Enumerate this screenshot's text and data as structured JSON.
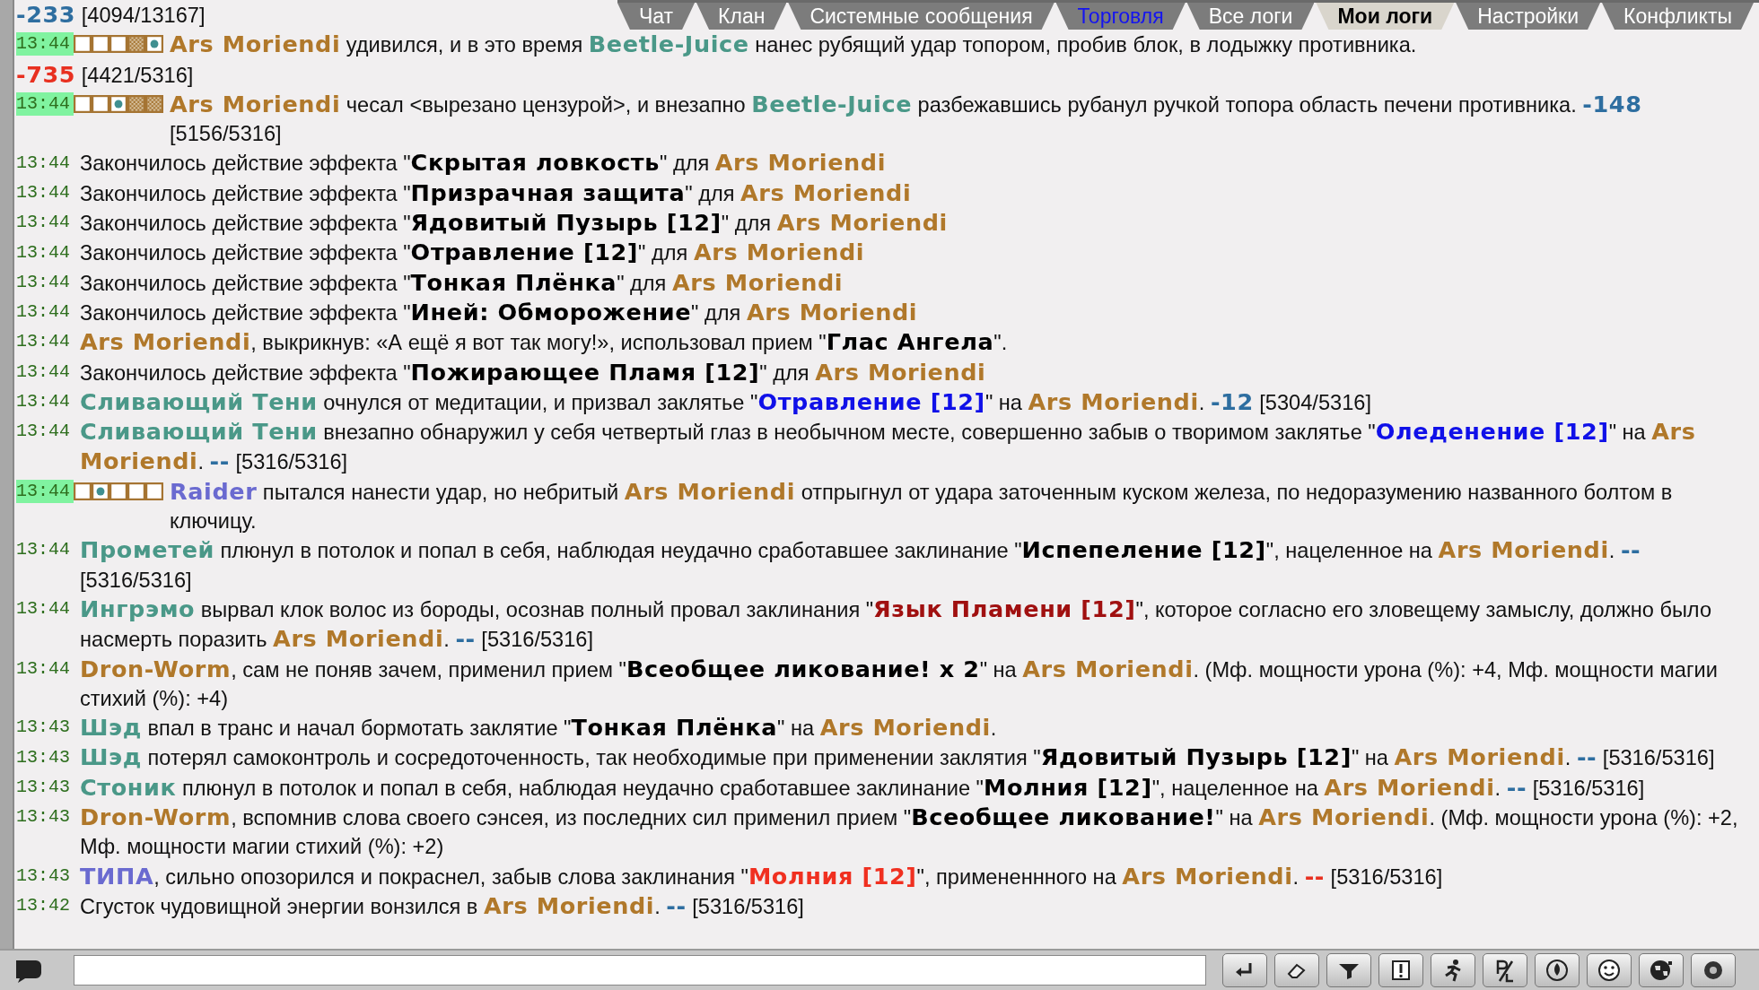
{
  "tabs": [
    {
      "label": "Чат",
      "selected": false,
      "unread": false
    },
    {
      "label": "Клан",
      "selected": false,
      "unread": false
    },
    {
      "label": "Системные сообщения",
      "selected": false,
      "unread": false
    },
    {
      "label": "Торговля",
      "selected": false,
      "unread": true
    },
    {
      "label": "Все логи",
      "selected": false,
      "unread": false
    },
    {
      "label": "Мои логи",
      "selected": true,
      "unread": false
    },
    {
      "label": "Настройки",
      "selected": false,
      "unread": false
    },
    {
      "label": "Конфликты",
      "selected": false,
      "unread": false
    }
  ],
  "log": [
    {
      "segments": [
        {
          "kind": "damage-blue",
          "text": "-233"
        },
        {
          "kind": "text",
          "text": " [4094/13167]"
        }
      ]
    },
    {
      "time": "13:44",
      "highlighted": true,
      "marks": [
        {
          "kind": "empty"
        },
        {
          "kind": "empty"
        },
        {
          "kind": "empty"
        },
        {
          "kind": "hatched"
        },
        {
          "kind": "target"
        }
      ],
      "segments": [
        {
          "kind": "player",
          "text": "Ars Moriendi"
        },
        {
          "kind": "text",
          "text": " удивился, и в это время "
        },
        {
          "kind": "ally",
          "text": "Beetle-Juice"
        },
        {
          "kind": "text",
          "text": " нанес рубящий удар топором, пробив блок, в лодыжку противника."
        }
      ]
    },
    {
      "segments": [
        {
          "kind": "damage-red",
          "text": "-735"
        },
        {
          "kind": "text",
          "text": " [4421/5316]"
        }
      ]
    },
    {
      "time": "13:44",
      "highlighted": true,
      "marks": [
        {
          "kind": "empty"
        },
        {
          "kind": "empty"
        },
        {
          "kind": "target"
        },
        {
          "kind": "hatched"
        },
        {
          "kind": "hatched"
        }
      ],
      "segments": [
        {
          "kind": "player",
          "text": "Ars Moriendi"
        },
        {
          "kind": "text",
          "text": " чесал <вырезано цензурой>, и внезапно "
        },
        {
          "kind": "ally",
          "text": "Beetle-Juice"
        },
        {
          "kind": "text",
          "text": " разбежавшись рубанул ручкой топора область печени противника. "
        },
        {
          "kind": "damage-blue",
          "text": "-148"
        },
        {
          "kind": "text",
          "text": " [5156/5316]"
        }
      ]
    },
    {
      "time": "13:44",
      "highlighted": false,
      "segments": [
        {
          "kind": "text",
          "text": "Закончилось действие эффекта \""
        },
        {
          "kind": "skill",
          "text": "Скрытая ловкость"
        },
        {
          "kind": "text",
          "text": "\" для "
        },
        {
          "kind": "player",
          "text": "Ars Moriendi"
        }
      ]
    },
    {
      "time": "13:44",
      "highlighted": false,
      "segments": [
        {
          "kind": "text",
          "text": "Закончилось действие эффекта \""
        },
        {
          "kind": "skill",
          "text": "Призрачная защита"
        },
        {
          "kind": "text",
          "text": "\" для "
        },
        {
          "kind": "player",
          "text": "Ars Moriendi"
        }
      ]
    },
    {
      "time": "13:44",
      "highlighted": false,
      "segments": [
        {
          "kind": "text",
          "text": "Закончилось действие эффекта \""
        },
        {
          "kind": "skill",
          "text": "Ядовитый Пузырь [12]"
        },
        {
          "kind": "text",
          "text": "\" для "
        },
        {
          "kind": "player",
          "text": "Ars Moriendi"
        }
      ]
    },
    {
      "time": "13:44",
      "highlighted": false,
      "segments": [
        {
          "kind": "text",
          "text": "Закончилось действие эффекта \""
        },
        {
          "kind": "skill",
          "text": "Отравление [12]"
        },
        {
          "kind": "text",
          "text": "\" для "
        },
        {
          "kind": "player",
          "text": "Ars Moriendi"
        }
      ]
    },
    {
      "time": "13:44",
      "highlighted": false,
      "segments": [
        {
          "kind": "text",
          "text": "Закончилось действие эффекта \""
        },
        {
          "kind": "skill",
          "text": "Тонкая Плёнка"
        },
        {
          "kind": "text",
          "text": "\" для "
        },
        {
          "kind": "player",
          "text": "Ars Moriendi"
        }
      ]
    },
    {
      "time": "13:44",
      "highlighted": false,
      "segments": [
        {
          "kind": "text",
          "text": "Закончилось действие эффекта \""
        },
        {
          "kind": "skill",
          "text": "Иней: Обморожение"
        },
        {
          "kind": "text",
          "text": "\" для "
        },
        {
          "kind": "player",
          "text": "Ars Moriendi"
        }
      ]
    },
    {
      "time": "13:44",
      "highlighted": false,
      "segments": [
        {
          "kind": "player",
          "text": "Ars Moriendi"
        },
        {
          "kind": "text",
          "text": ", выкрикнув: «А ещё я вот так могу!», использовал прием \""
        },
        {
          "kind": "skill",
          "text": "Глас Ангела"
        },
        {
          "kind": "text",
          "text": "\"."
        }
      ]
    },
    {
      "time": "13:44",
      "highlighted": false,
      "segments": [
        {
          "kind": "text",
          "text": "Закончилось действие эффекта \""
        },
        {
          "kind": "skill",
          "text": "Пожирающее Пламя [12]"
        },
        {
          "kind": "text",
          "text": "\" для "
        },
        {
          "kind": "player",
          "text": "Ars Moriendi"
        }
      ]
    },
    {
      "time": "13:44",
      "highlighted": false,
      "segments": [
        {
          "kind": "ally",
          "text": "Сливающий Тени"
        },
        {
          "kind": "text",
          "text": " очнулся от медитации, и призвал заклятье \""
        },
        {
          "kind": "spell-blue",
          "text": "Отравление [12]"
        },
        {
          "kind": "text",
          "text": "\" на "
        },
        {
          "kind": "player",
          "text": "Ars Moriendi"
        },
        {
          "kind": "text",
          "text": ". "
        },
        {
          "kind": "damage-blue",
          "text": "-12"
        },
        {
          "kind": "text",
          "text": " [5304/5316]"
        }
      ]
    },
    {
      "time": "13:44",
      "highlighted": false,
      "segments": [
        {
          "kind": "ally",
          "text": "Сливающий Тени"
        },
        {
          "kind": "text",
          "text": " внезапно обнаружил у себя четвертый глаз в необычном месте, совершенно забыв о творимом заклятье \""
        },
        {
          "kind": "spell-blue",
          "text": "Оледенение [12]"
        },
        {
          "kind": "text",
          "text": "\" на "
        },
        {
          "kind": "player",
          "text": "Ars Moriendi"
        },
        {
          "kind": "text",
          "text": ". "
        },
        {
          "kind": "damage-blue",
          "text": "--"
        },
        {
          "kind": "text",
          "text": " [5316/5316]"
        }
      ]
    },
    {
      "time": "13:44",
      "highlighted": true,
      "marks": [
        {
          "kind": "empty"
        },
        {
          "kind": "target"
        },
        {
          "kind": "empty"
        },
        {
          "kind": "empty"
        },
        {
          "kind": "empty"
        }
      ],
      "segments": [
        {
          "kind": "foe",
          "text": "Raider"
        },
        {
          "kind": "text",
          "text": " пытался нанести удар, но небритый "
        },
        {
          "kind": "player",
          "text": "Ars Moriendi"
        },
        {
          "kind": "text",
          "text": " отпрыгнул от удара заточенным куском железа, по недоразумению названного болтом в ключицу."
        }
      ]
    },
    {
      "time": "13:44",
      "highlighted": false,
      "segments": [
        {
          "kind": "ally",
          "text": "Прометей"
        },
        {
          "kind": "text",
          "text": " плюнул в потолок и попал в себя, наблюдая неудачно сработавшее заклинание \""
        },
        {
          "kind": "skill",
          "text": "Испепеление [12]"
        },
        {
          "kind": "text",
          "text": "\", нацеленное на "
        },
        {
          "kind": "player",
          "text": "Ars Moriendi"
        },
        {
          "kind": "text",
          "text": ". "
        },
        {
          "kind": "damage-blue",
          "text": "--"
        },
        {
          "kind": "text",
          "text": " [5316/5316]"
        }
      ]
    },
    {
      "time": "13:44",
      "highlighted": false,
      "segments": [
        {
          "kind": "ally",
          "text": "Ингрэмо"
        },
        {
          "kind": "text",
          "text": " вырвал клок волос из бороды, осознав полный провал заклинания \""
        },
        {
          "kind": "spell-dark",
          "text": "Язык Пламени [12]"
        },
        {
          "kind": "text",
          "text": "\", которое согласно его зловещему замыслу, должно было насмерть поразить "
        },
        {
          "kind": "player",
          "text": "Ars Moriendi"
        },
        {
          "kind": "text",
          "text": ". "
        },
        {
          "kind": "damage-blue",
          "text": "--"
        },
        {
          "kind": "text",
          "text": " [5316/5316]"
        }
      ]
    },
    {
      "time": "13:44",
      "highlighted": false,
      "segments": [
        {
          "kind": "player",
          "text": "Dron-Worm"
        },
        {
          "kind": "text",
          "text": ", сам не поняв зачем, применил прием \""
        },
        {
          "kind": "skill",
          "text": "Всеобщее ликование! x 2"
        },
        {
          "kind": "text",
          "text": "\" на "
        },
        {
          "kind": "player",
          "text": "Ars Moriendi"
        },
        {
          "kind": "text",
          "text": ". (Мф. мощности урона (%): +4, Мф. мощности магии стихий (%): +4)"
        }
      ]
    },
    {
      "time": "13:43",
      "highlighted": false,
      "segments": [
        {
          "kind": "ally",
          "text": "Шэд"
        },
        {
          "kind": "text",
          "text": " впал в транс и начал бормотать заклятие \""
        },
        {
          "kind": "skill",
          "text": "Тонкая Плёнка"
        },
        {
          "kind": "text",
          "text": "\" на "
        },
        {
          "kind": "player",
          "text": "Ars Moriendi"
        },
        {
          "kind": "text",
          "text": "."
        }
      ]
    },
    {
      "time": "13:43",
      "highlighted": false,
      "segments": [
        {
          "kind": "ally",
          "text": "Шэд"
        },
        {
          "kind": "text",
          "text": " потерял самоконтроль и сосредоточенность, так необходимые при применении заклятия \""
        },
        {
          "kind": "skill",
          "text": "Ядовитый Пузырь [12]"
        },
        {
          "kind": "text",
          "text": "\" на "
        },
        {
          "kind": "player",
          "text": "Ars Moriendi"
        },
        {
          "kind": "text",
          "text": ". "
        },
        {
          "kind": "damage-blue",
          "text": "--"
        },
        {
          "kind": "text",
          "text": " [5316/5316]"
        }
      ]
    },
    {
      "time": "13:43",
      "highlighted": false,
      "segments": [
        {
          "kind": "ally",
          "text": "Стоник"
        },
        {
          "kind": "text",
          "text": " плюнул в потолок и попал в себя, наблюдая неудачно сработавшее заклинание \""
        },
        {
          "kind": "skill",
          "text": "Молния [12]"
        },
        {
          "kind": "text",
          "text": "\", нацеленное на "
        },
        {
          "kind": "player",
          "text": "Ars Moriendi"
        },
        {
          "kind": "text",
          "text": ". "
        },
        {
          "kind": "damage-blue",
          "text": "--"
        },
        {
          "kind": "text",
          "text": " [5316/5316]"
        }
      ]
    },
    {
      "time": "13:43",
      "highlighted": false,
      "segments": [
        {
          "kind": "player",
          "text": "Dron-Worm"
        },
        {
          "kind": "text",
          "text": ", вспомнив слова своего сэнсея, из последних сил применил прием \""
        },
        {
          "kind": "skill",
          "text": "Всеобщее ликование!"
        },
        {
          "kind": "text",
          "text": "\" на "
        },
        {
          "kind": "player",
          "text": "Ars Moriendi"
        },
        {
          "kind": "text",
          "text": ". (Мф. мощности урона (%): +2, Мф. мощности магии стихий (%): +2)"
        }
      ]
    },
    {
      "time": "13:43",
      "highlighted": false,
      "segments": [
        {
          "kind": "foe",
          "text": "ТИПА"
        },
        {
          "kind": "text",
          "text": ", сильно опозорился и покраснел, забыв слова заклинания \""
        },
        {
          "kind": "spell-red",
          "text": "Молния [12]"
        },
        {
          "kind": "text",
          "text": "\", примененнного на "
        },
        {
          "kind": "player",
          "text": "Ars Moriendi"
        },
        {
          "kind": "text",
          "text": ". "
        },
        {
          "kind": "damage-red",
          "text": "--"
        },
        {
          "kind": "text",
          "text": " [5316/5316]"
        }
      ]
    },
    {
      "time": "13:42",
      "highlighted": false,
      "segments": [
        {
          "kind": "text",
          "text": "Сгусток чудовищной энергии вонзился в "
        },
        {
          "kind": "player",
          "text": "Ars Moriendi"
        },
        {
          "kind": "text",
          "text": ". "
        },
        {
          "kind": "damage-blue",
          "text": "--"
        },
        {
          "kind": "text",
          "text": " [5316/5316]"
        }
      ]
    }
  ]
}
